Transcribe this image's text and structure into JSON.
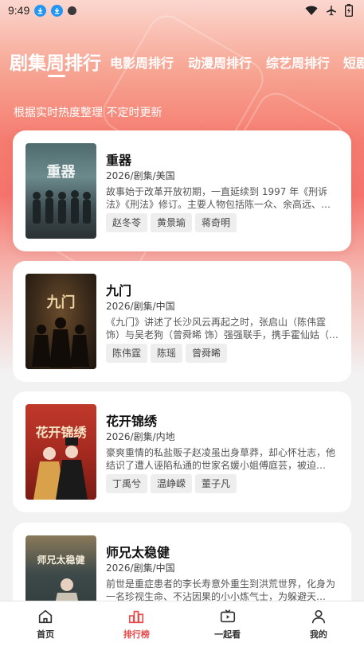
{
  "status_bar": {
    "time": "9:49",
    "icons": [
      "download-icon",
      "download-icon",
      "dot-icon",
      "wifi-icon",
      "airplane-icon",
      "battery-icon"
    ]
  },
  "tabs": [
    {
      "label": "剧集周排行",
      "active": true
    },
    {
      "label": "电影周排行",
      "active": false
    },
    {
      "label": "动漫周排行",
      "active": false
    },
    {
      "label": "综艺周排行",
      "active": false
    },
    {
      "label": "短剧周排行",
      "active": false
    }
  ],
  "subtitle": "根据实时热度整理 不定时更新",
  "items": [
    {
      "poster_title": "重器",
      "title": "重器",
      "meta": "2026/剧集/美国",
      "desc": "故事始于改革开放初期，一直延续到 1997 年《刑诉法》《刑法》修订。主要人物包括陈一众、余高远、…",
      "tags": [
        "赵冬苓",
        "黄景瑜",
        "蒋奇明"
      ]
    },
    {
      "poster_title": "九门",
      "title": "九门",
      "meta": "2026/剧集/中国",
      "desc": "《九门》讲述了长沙风云再起之时，张启山（陈伟霆 饰）与吴老狗（曾舜晞 饰）强强联手，携手霍仙姑（…",
      "tags": [
        "陈伟霆",
        "陈瑶",
        "曾舜晞"
      ]
    },
    {
      "poster_title": "花开锦绣",
      "title": "花开锦绣",
      "meta": "2026/剧集/内地",
      "desc": "豪爽重情的私盐贩子赵凌虽出身草莽，却心怀壮志，他结识了遭人诬陷私通的世家名媛小姐傅庭芸，被迫…",
      "tags": [
        "丁禹兮",
        "温峥嵘",
        "董子凡"
      ]
    },
    {
      "poster_title": "师兄太稳健",
      "title": "师兄太稳健",
      "meta": "2026/剧集/中国",
      "desc": "前世是重症患者的李长寿意外重生到洪荒世界，化身为一名珍视生命、不沾因果的小小炼气士，为躲避天…",
      "tags": []
    }
  ],
  "bottom_nav": [
    {
      "label": "首页",
      "icon": "home-icon",
      "active": false
    },
    {
      "label": "排行榜",
      "icon": "ranking-icon",
      "active": true
    },
    {
      "label": "一起看",
      "icon": "tv-icon",
      "active": false
    },
    {
      "label": "我的",
      "icon": "profile-icon",
      "active": false
    }
  ],
  "colors": {
    "accent": "#e84a4a",
    "hero_top": "#fbd7cf",
    "hero_mid": "#f5736c",
    "background": "#f2f2f2"
  }
}
